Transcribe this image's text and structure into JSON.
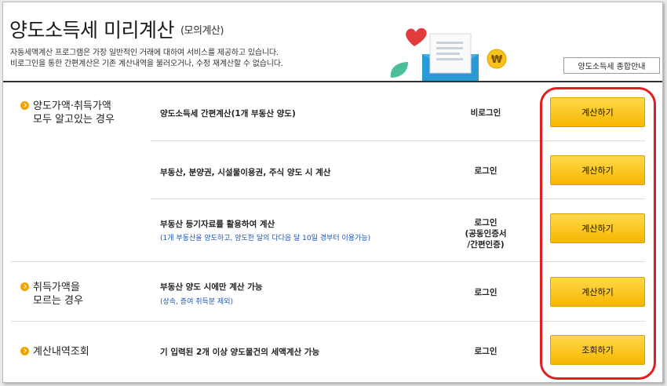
{
  "header": {
    "title": "양도소득세 미리계산",
    "subtitle": "(모의계산)",
    "desc_line1": "자동세액계산 프로그램은 가장 일반적인 거래에 대하여 서비스를 제공하고 있습니다.",
    "desc_line2": "비로그인을 통한 간편계산은 기존 계산내역을 불러오거나, 수정 재계산할 수 없습니다.",
    "guide_button": "양도소득세 종합안내"
  },
  "categories": {
    "c1_line1": "양도가액·취득가액",
    "c1_line2": "모두 알고있는 경우",
    "c2_line1": "취득가액을",
    "c2_line2": "모르는 경우",
    "c3_line1": "계산내역조회"
  },
  "rows": [
    {
      "service": "양도소득세 간편계산(1개 부동산 양도)",
      "note": "",
      "login": "비로그인",
      "button": "계산하기"
    },
    {
      "service": "부동산, 분양권, 시설물이용권, 주식 양도 시 계산",
      "note": "",
      "login": "로그인",
      "button": "계산하기"
    },
    {
      "service": "부동산 등기자료를 활용하여 계산",
      "note": "(1개 부동산을 양도하고, 양도한 달의 다다음 달 10일 경부터 이용가능)",
      "login_line1": "로그인",
      "login_line2": "(공동인증서",
      "login_line3": "/간편인증)",
      "button": "계산하기"
    },
    {
      "service": "부동산 양도 시에만 계산 가능",
      "note": "(상속, 증여 취득분 제외)",
      "login": "로그인",
      "button": "계산하기"
    },
    {
      "service": "기 입력된 2개 이상 양도물건의 세액계산 가능",
      "note": "",
      "login": "로그인",
      "button": "조회하기"
    }
  ],
  "colors": {
    "accent_button": "#f7b600",
    "highlight_box": "#e02020",
    "note_text": "#1a56b8",
    "bullet": "#f3a300"
  },
  "icons": [
    "heart-icon",
    "document-icon",
    "envelope-icon",
    "won-coin-icon",
    "leaf-icon",
    "arrow-bullet-icon"
  ]
}
